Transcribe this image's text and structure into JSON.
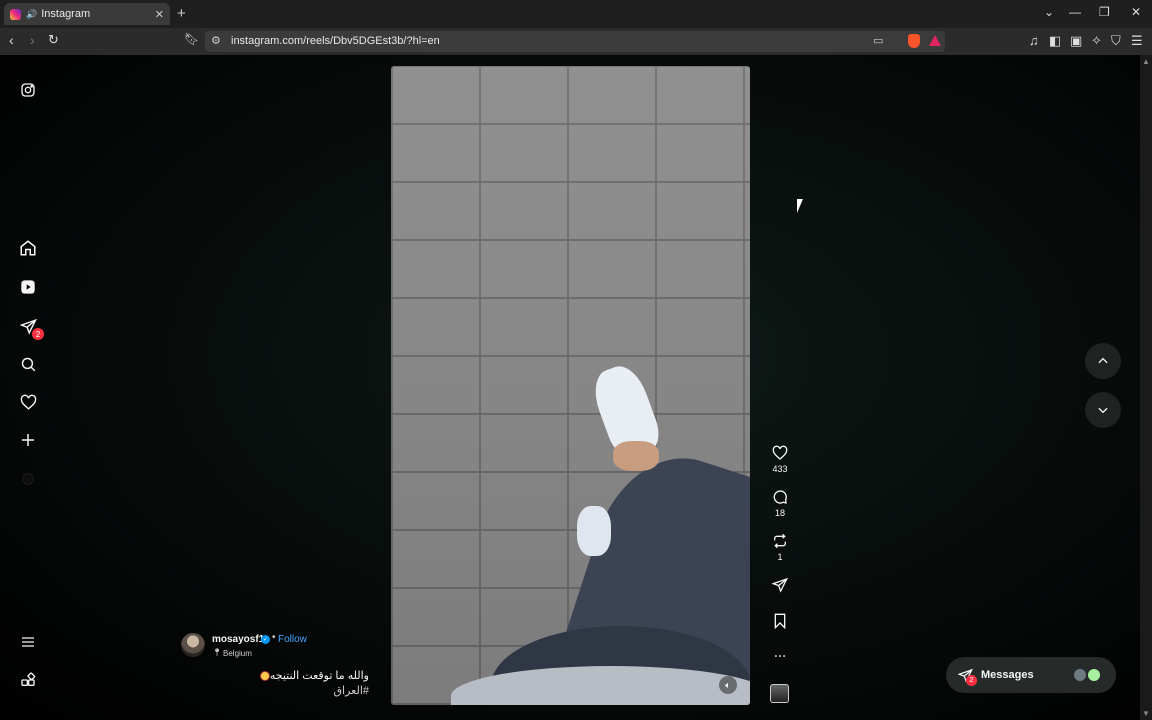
{
  "browser": {
    "tab_title": "Instagram",
    "new_tab_symbol": "+",
    "close_symbol": "✕",
    "url": "instagram.com/reels/Dbv5DGEst3b/?hl=en"
  },
  "sidebar": {
    "items": [
      {
        "name": "instagram-logo"
      },
      {
        "name": "home"
      },
      {
        "name": "reels"
      },
      {
        "name": "direct-messages",
        "badge": "2"
      },
      {
        "name": "search"
      },
      {
        "name": "notifications"
      },
      {
        "name": "create"
      },
      {
        "name": "profile"
      },
      {
        "name": "more-menu"
      },
      {
        "name": "also-from-meta"
      }
    ]
  },
  "reel": {
    "username": "mosayosf1",
    "follow_label": "Follow",
    "dot": "•",
    "location": "Belgium",
    "caption": "والله ما توقعت النتيجه",
    "hashtag": "#العراق",
    "likes": "433",
    "comments": "18",
    "reposts": "1"
  },
  "messages": {
    "label": "Messages",
    "badge": "2"
  },
  "colors": {
    "accent_blue": "#0095f6",
    "badge_red": "#ff3040",
    "background": "#000000"
  }
}
